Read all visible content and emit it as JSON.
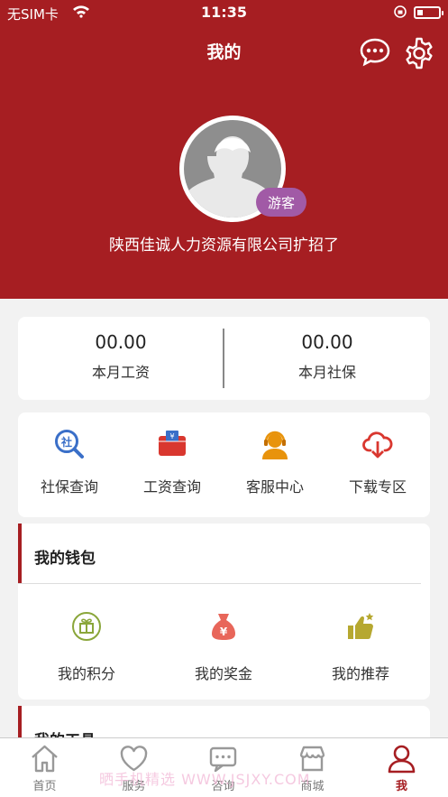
{
  "status_bar": {
    "carrier": "无SIM卡",
    "time": "11:35"
  },
  "header": {
    "title": "我的",
    "badge": "游客",
    "company": "陕西佳诚人力资源有限公司扩招了"
  },
  "stats": [
    {
      "value": "00.00",
      "label": "本月工资"
    },
    {
      "value": "00.00",
      "label": "本月社保"
    }
  ],
  "quick_links": [
    {
      "label": "社保查询",
      "icon": "social-insurance-search-icon",
      "color": "#3a6fc8"
    },
    {
      "label": "工资查询",
      "icon": "salary-wallet-icon",
      "color": "#d9372f"
    },
    {
      "label": "客服中心",
      "icon": "customer-service-icon",
      "color": "#e8930c"
    },
    {
      "label": "下载专区",
      "icon": "cloud-download-icon",
      "color": "#d9372f"
    }
  ],
  "wallet": {
    "title": "我的钱包",
    "items": [
      {
        "label": "我的积分",
        "icon": "gift-points-icon",
        "color": "#8aa63a"
      },
      {
        "label": "我的奖金",
        "icon": "money-bag-icon",
        "color": "#e8665a"
      },
      {
        "label": "我的推荐",
        "icon": "thumbs-up-icon",
        "color": "#b6a830"
      }
    ]
  },
  "tools": {
    "title": "我的工具"
  },
  "tabs": [
    {
      "label": "首页",
      "icon": "home-icon"
    },
    {
      "label": "服务",
      "icon": "heart-icon"
    },
    {
      "label": "咨询",
      "icon": "chat-icon"
    },
    {
      "label": "商城",
      "icon": "store-icon"
    },
    {
      "label": "我",
      "icon": "user-icon",
      "active": true
    }
  ],
  "watermark": "晒手机精选 WWW.JSJXY.COM",
  "colors": {
    "brand": "#a61e22",
    "badge": "#a15aa6",
    "background": "#f2f2f2"
  }
}
